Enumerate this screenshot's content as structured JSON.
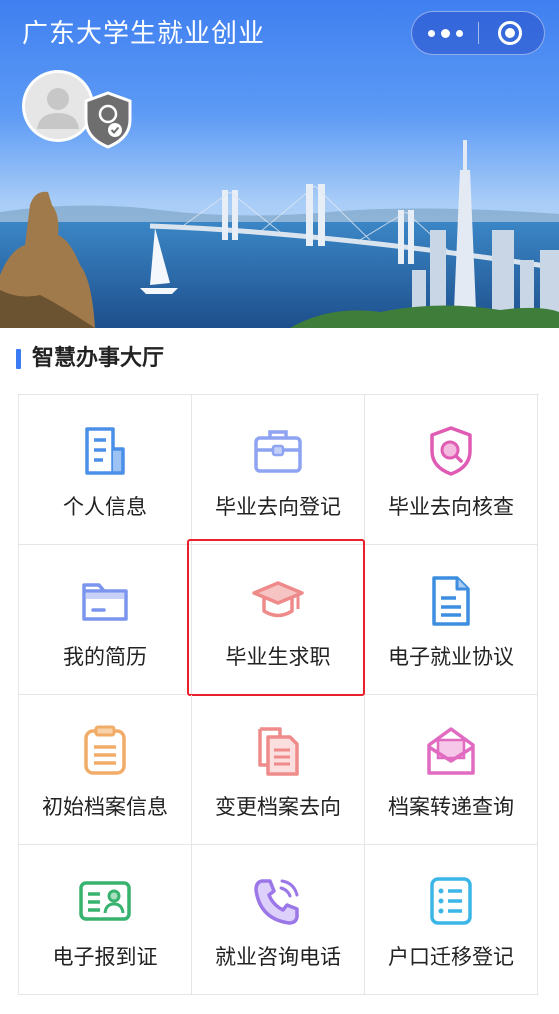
{
  "header": {
    "title": "广东大学生就业创业"
  },
  "capsule": {
    "more_icon": "more-dots-icon",
    "close_icon": "miniprogram-close-icon"
  },
  "profile": {
    "avatar_icon": "user-avatar-icon",
    "badge_icon": "verified-shield-icon"
  },
  "section": {
    "title": "智慧办事大厅"
  },
  "colors": {
    "accent": "#3b7cf4",
    "highlight": "#e8202a"
  },
  "services": [
    {
      "label": "个人信息",
      "icon": "document-icon",
      "color": "#4a8fe8"
    },
    {
      "label": "毕业去向登记",
      "icon": "briefcase-icon",
      "color": "#8ea3f2"
    },
    {
      "label": "毕业去向核查",
      "icon": "shield-search-icon",
      "color": "#e05bb3"
    },
    {
      "label": "我的简历",
      "icon": "folder-icon",
      "color": "#7b95ee"
    },
    {
      "label": "毕业生求职",
      "icon": "graduation-cap-icon",
      "color": "#ef8a8a",
      "highlighted": true
    },
    {
      "label": "电子就业协议",
      "icon": "file-text-icon",
      "color": "#3d8ee0"
    },
    {
      "label": "初始档案信息",
      "icon": "list-doc-icon",
      "color": "#f1ac68"
    },
    {
      "label": "变更档案去向",
      "icon": "copy-files-icon",
      "color": "#ef8b8b"
    },
    {
      "label": "档案转递查询",
      "icon": "envelope-open-icon",
      "color": "#e06bc1"
    },
    {
      "label": "电子报到证",
      "icon": "id-card-icon",
      "color": "#38b26f"
    },
    {
      "label": "就业咨询电话",
      "icon": "phone-call-icon",
      "color": "#9b77e8"
    },
    {
      "label": "户口迁移登记",
      "icon": "checklist-icon",
      "color": "#3bb6e6"
    }
  ]
}
